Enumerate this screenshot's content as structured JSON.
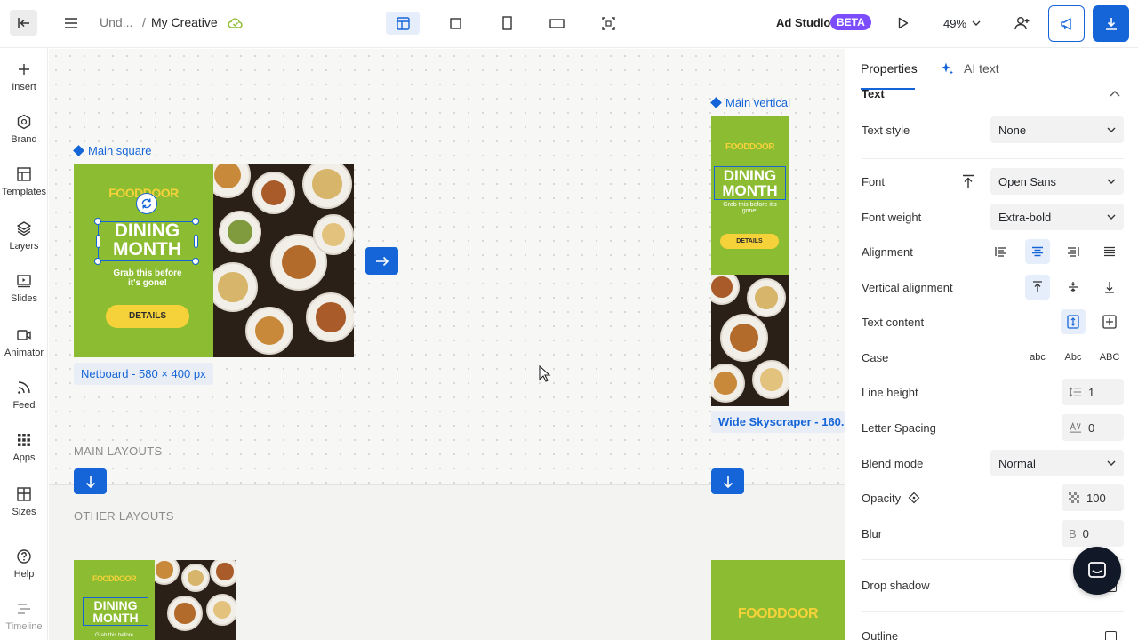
{
  "topbar": {
    "breadcrumb_parent": "Und...",
    "breadcrumb_sep": "/",
    "title": "My Creative",
    "studio_label": "Ad Studio",
    "beta_badge": "BETA",
    "zoom": "49%"
  },
  "rail": {
    "items": [
      {
        "label": "Insert",
        "icon": "plus-icon"
      },
      {
        "label": "Brand",
        "icon": "brand-icon"
      },
      {
        "label": "Templates",
        "icon": "templates-icon"
      },
      {
        "label": "Layers",
        "icon": "layers-icon"
      },
      {
        "label": "Slides",
        "icon": "slides-icon"
      },
      {
        "label": "Animator",
        "icon": "animator-icon"
      },
      {
        "label": "Feed",
        "icon": "feed-icon"
      },
      {
        "label": "Apps",
        "icon": "apps-icon"
      },
      {
        "label": "Sizes",
        "icon": "sizes-icon"
      },
      {
        "label": "Help",
        "icon": "help-icon"
      },
      {
        "label": "Timeline",
        "icon": "timeline-icon"
      }
    ]
  },
  "canvas": {
    "main_square_label": "Main square",
    "main_vertical_label": "Main vertical",
    "netboard_size": "Netboard - 580 × 400 px",
    "skyscraper_size": "Wide Skyscraper - 160...",
    "main_layouts": "MAIN LAYOUTS",
    "other_layouts": "OTHER LAYOUTS",
    "ad": {
      "logo": "FOODDOOR",
      "headline_line1": "DINING",
      "headline_line2": "MONTH",
      "sub_line1": "Grab this before",
      "sub_line2": "it's gone!",
      "sub_small_line1": "Grab this before it's",
      "sub_small_line2": "gone!",
      "cta": "DETAILS",
      "brand_color": "#8cbc31",
      "accent_color": "#f6d23a"
    }
  },
  "panel": {
    "tabs": {
      "properties": "Properties",
      "ai_text": "AI text"
    },
    "section_title": "Text",
    "text_style": {
      "label": "Text style",
      "value": "None"
    },
    "font": {
      "label": "Font",
      "value": "Open Sans"
    },
    "font_weight": {
      "label": "Font weight",
      "value": "Extra-bold"
    },
    "alignment": {
      "label": "Alignment",
      "selected": "center"
    },
    "vertical_alignment": {
      "label": "Vertical alignment",
      "selected": "top"
    },
    "text_content": {
      "label": "Text content"
    },
    "case": {
      "label": "Case",
      "options": [
        "abc",
        "Abc",
        "ABC"
      ]
    },
    "line_height": {
      "label": "Line height",
      "value": "1"
    },
    "letter_spacing": {
      "label": "Letter Spacing",
      "value": "0"
    },
    "blend_mode": {
      "label": "Blend mode",
      "value": "Normal"
    },
    "opacity": {
      "label": "Opacity",
      "value": "100"
    },
    "blur": {
      "label": "Blur",
      "prefix": "B",
      "value": "0"
    },
    "drop_shadow": {
      "label": "Drop shadow"
    },
    "outline": {
      "label": "Outline"
    }
  },
  "colors": {
    "accent": "#1565d8",
    "beta": "#7c4dff"
  }
}
